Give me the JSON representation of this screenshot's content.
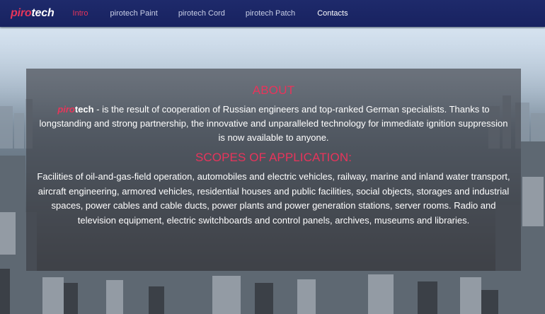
{
  "brand": {
    "part1": "piro",
    "part2": "tech"
  },
  "nav": {
    "items": [
      {
        "label": "Intro",
        "active": true
      },
      {
        "label": "pirotech Paint",
        "active": false
      },
      {
        "label": "pirotech Cord",
        "active": false
      },
      {
        "label": "pirotech Patch",
        "active": false
      },
      {
        "label": "Contacts",
        "active": false
      }
    ]
  },
  "about": {
    "heading": "ABOUT",
    "brand_part1": "piro",
    "brand_part2": "tech",
    "text": " - is the result of cooperation of Russian engineers and top-ranked German specialists. Thanks to longstanding and strong partnership, the innovative and unparalleled technology for immediate ignition suppression is now available to anyone."
  },
  "scopes": {
    "heading": "SCOPES OF APPLICATION:",
    "text": "Facilities of oil-and-gas-field operation, automobiles and electric vehicles, railway, marine and inland water transport, aircraft engineering, armored vehicles, residential houses and public facilities, social objects, storages and industrial spaces, power cables and cable ducts, power plants and power generation stations, server rooms. Radio and television equipment, electric switchboards and control panels, archives, museums and libraries."
  },
  "colors": {
    "accent": "#e8355a",
    "navbar": "#1e2a6b",
    "panel": "rgba(58,60,66,0.62)"
  }
}
